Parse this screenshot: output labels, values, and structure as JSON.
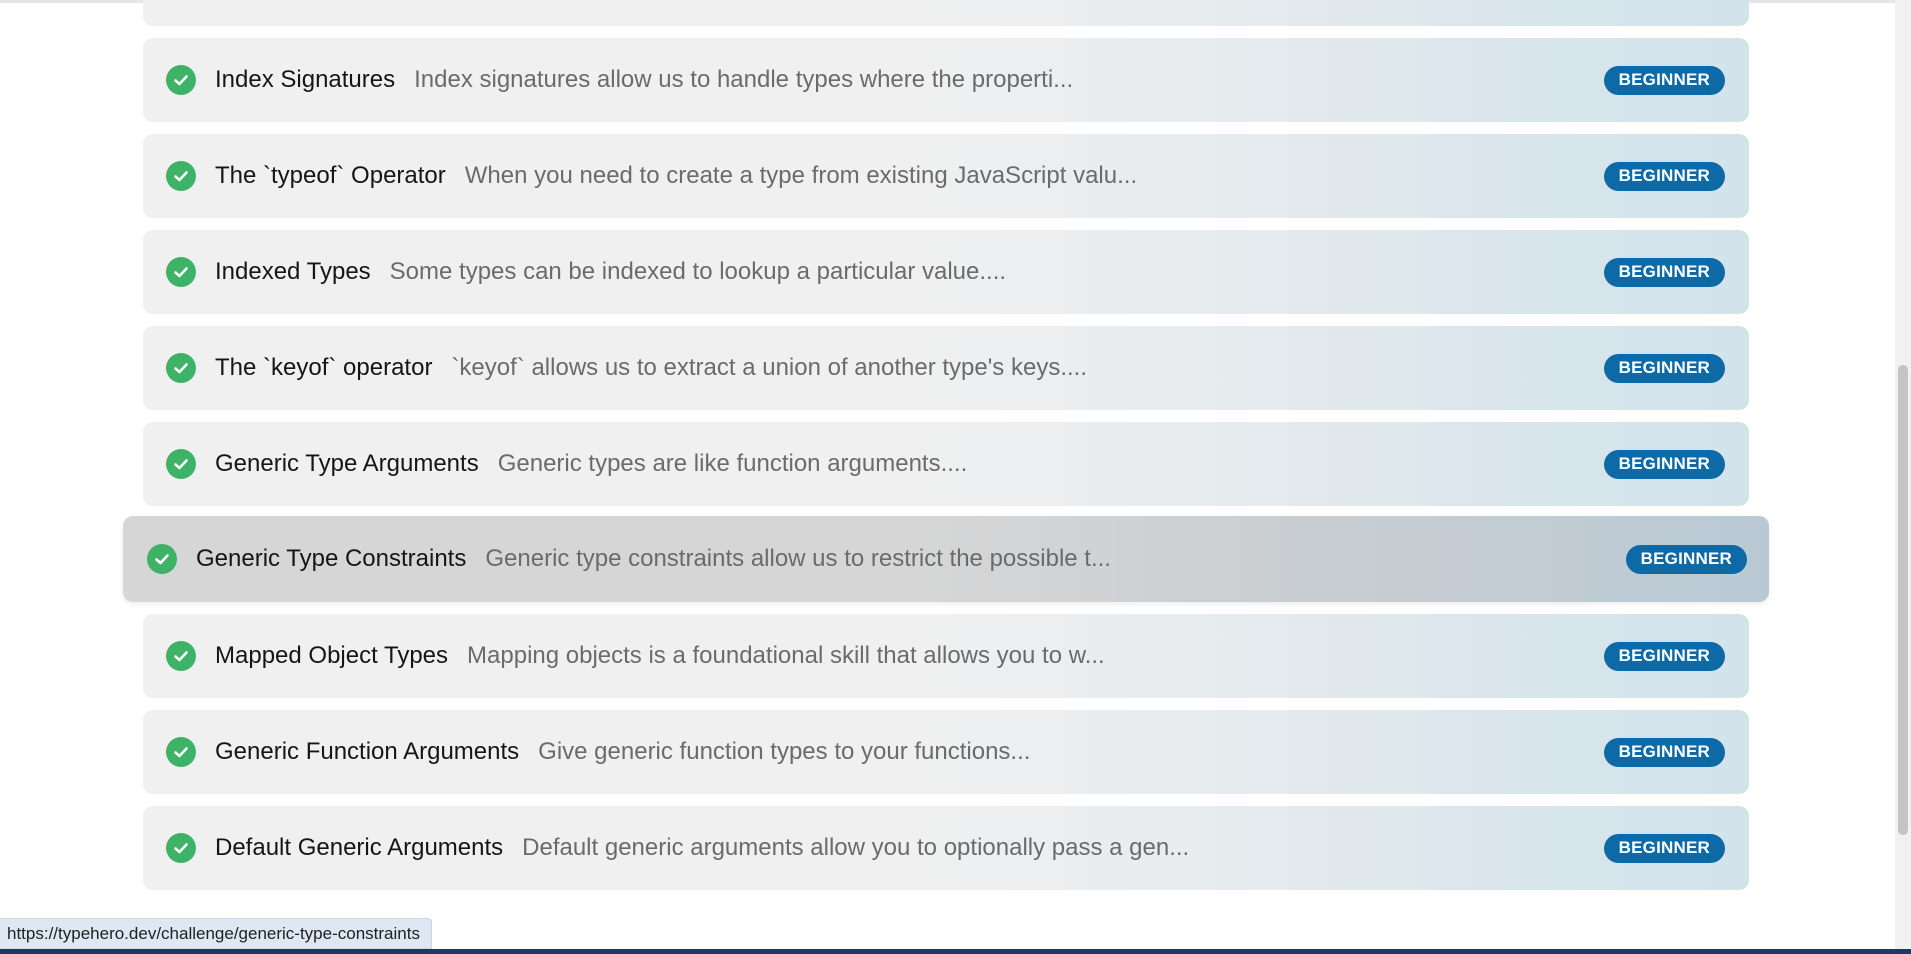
{
  "challenges": [
    {
      "title": "Index Signatures",
      "description": "Index signatures allow us to handle types where the properti...",
      "difficulty": "BEGINNER",
      "completed": true
    },
    {
      "title": "The `typeof` Operator",
      "description": "When you need to create a type from existing JavaScript valu...",
      "difficulty": "BEGINNER",
      "completed": true
    },
    {
      "title": "Indexed Types",
      "description": "Some types can be indexed to lookup a particular value....",
      "difficulty": "BEGINNER",
      "completed": true
    },
    {
      "title": "The `keyof` operator",
      "description": "`keyof` allows us to extract a union of another type's keys....",
      "difficulty": "BEGINNER",
      "completed": true
    },
    {
      "title": "Generic Type Arguments",
      "description": "Generic types are like function arguments....",
      "difficulty": "BEGINNER",
      "completed": true
    },
    {
      "title": "Generic Type Constraints",
      "description": "Generic type constraints allow us to restrict the possible t...",
      "difficulty": "BEGINNER",
      "completed": true,
      "hovered": true
    },
    {
      "title": "Mapped Object Types",
      "description": "Mapping objects is a foundational skill that allows you to w...",
      "difficulty": "BEGINNER",
      "completed": true
    },
    {
      "title": "Generic Function Arguments",
      "description": "Give generic function types to your functions...",
      "difficulty": "BEGINNER",
      "completed": true
    },
    {
      "title": "Default Generic Arguments",
      "description": "Default generic arguments allow you to optionally pass a gen...",
      "difficulty": "BEGINNER",
      "completed": true
    }
  ],
  "status_bar": {
    "url": "https://typehero.dev/challenge/generic-type-constraints"
  },
  "colors": {
    "check": "#3eb368",
    "badge": "#0d6aa6"
  },
  "icons": {
    "completed": "check-circle-icon"
  }
}
